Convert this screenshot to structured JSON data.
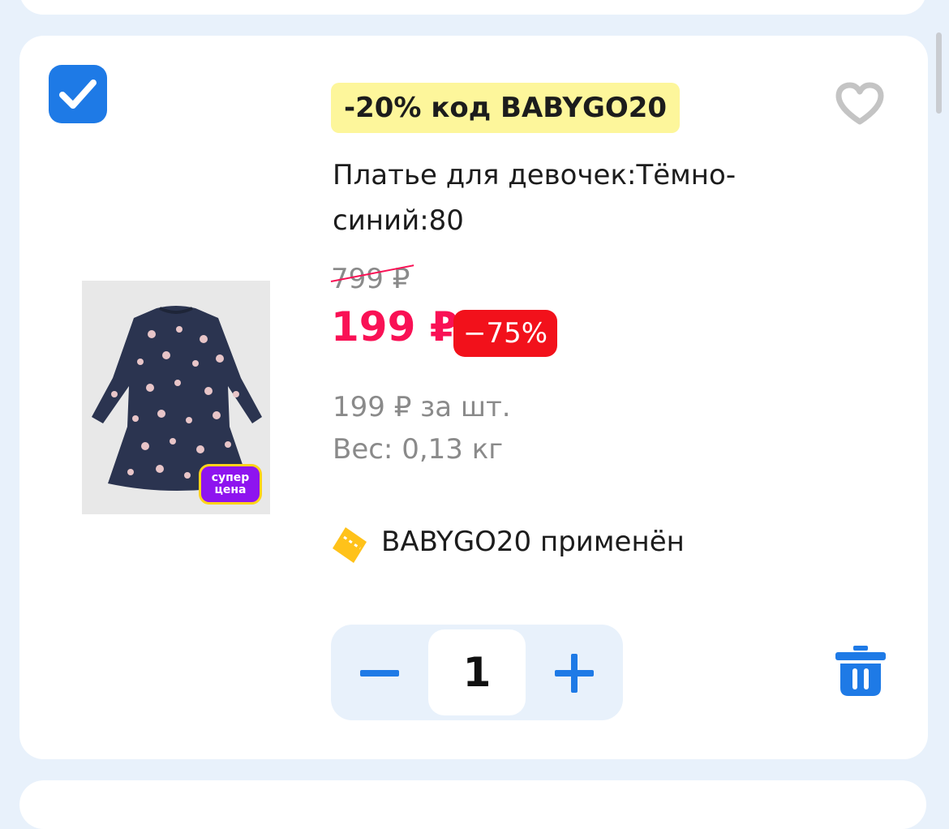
{
  "product": {
    "promo_label": "-20% код BABYGO20",
    "title": "Платье для девочек:Тёмно-синий:80",
    "old_price": "799 ₽",
    "new_price": "199 ₽",
    "discount": "−75%",
    "unit_price": "199 ₽ за шт.",
    "weight": "Вес: 0,13 кг",
    "badge_line1": "супер",
    "badge_line2": "цена",
    "selected": true
  },
  "coupon": {
    "text": "BABYGO20 применён"
  },
  "quantity": {
    "value": "1"
  },
  "colors": {
    "accent": "#1e7ae6",
    "price_red": "#f91155",
    "discount_bg": "#f2111b",
    "promo_bg": "#fdf69b",
    "super_badge": "#8e14ef"
  },
  "icons": [
    "checkmark-icon",
    "heart-icon",
    "ticket-icon",
    "minus-icon",
    "plus-icon",
    "trash-icon"
  ]
}
